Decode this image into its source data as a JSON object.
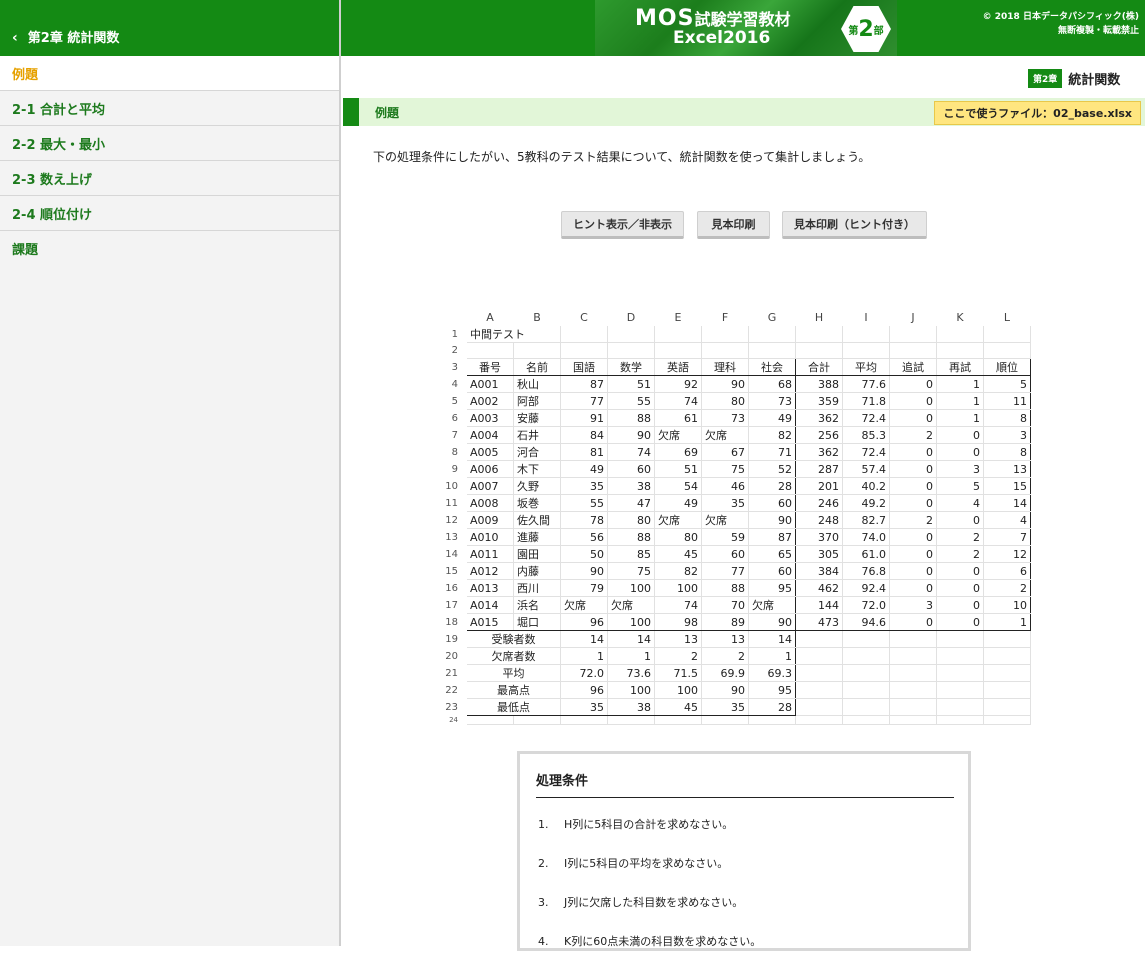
{
  "sidebar": {
    "header": "第2章 統計関数",
    "items": [
      {
        "label": "例題",
        "active": true
      },
      {
        "label": "2-1 合計と平均"
      },
      {
        "label": "2-2 最大・最小"
      },
      {
        "label": "2-3 数え上げ"
      },
      {
        "label": "2-4 順位付け"
      },
      {
        "label": "課題"
      }
    ]
  },
  "banner": {
    "line1a": "MOS",
    "line1b": "試験学習教材",
    "line2": "Excel2016",
    "part_pre": "第",
    "part_num": "2",
    "part_post": "部"
  },
  "copyright": {
    "line1": "© 2018 日本データパシフィック(株)",
    "line2": "無断複製・転載禁止"
  },
  "chapter": {
    "badge": "第2章",
    "title": "統計関数"
  },
  "section": {
    "label": "例題",
    "file": "ここで使うファイル：02_base.xlsx"
  },
  "intro": "下の処理条件にしたがい、5教科のテスト結果について、統計関数を使って集計しましょう。",
  "buttons": {
    "hint": "ヒント表示／非表示",
    "print": "見本印刷",
    "print_hint": "見本印刷（ヒント付き）"
  },
  "sheet": {
    "columns": [
      "A",
      "B",
      "C",
      "D",
      "E",
      "F",
      "G",
      "H",
      "I",
      "J",
      "K",
      "L"
    ],
    "title": "中間テスト",
    "headers": [
      "番号",
      "名前",
      "国語",
      "数学",
      "英語",
      "理科",
      "社会",
      "合計",
      "平均",
      "追試",
      "再試",
      "順位"
    ],
    "rows": [
      [
        "A001",
        "秋山",
        "87",
        "51",
        "92",
        "90",
        "68",
        "388",
        "77.6",
        "0",
        "1",
        "5"
      ],
      [
        "A002",
        "阿部",
        "77",
        "55",
        "74",
        "80",
        "73",
        "359",
        "71.8",
        "0",
        "1",
        "11"
      ],
      [
        "A003",
        "安藤",
        "91",
        "88",
        "61",
        "73",
        "49",
        "362",
        "72.4",
        "0",
        "1",
        "8"
      ],
      [
        "A004",
        "石井",
        "84",
        "90",
        "欠席",
        "欠席",
        "82",
        "256",
        "85.3",
        "2",
        "0",
        "3"
      ],
      [
        "A005",
        "河合",
        "81",
        "74",
        "69",
        "67",
        "71",
        "362",
        "72.4",
        "0",
        "0",
        "8"
      ],
      [
        "A006",
        "木下",
        "49",
        "60",
        "51",
        "75",
        "52",
        "287",
        "57.4",
        "0",
        "3",
        "13"
      ],
      [
        "A007",
        "久野",
        "35",
        "38",
        "54",
        "46",
        "28",
        "201",
        "40.2",
        "0",
        "5",
        "15"
      ],
      [
        "A008",
        "坂巻",
        "55",
        "47",
        "49",
        "35",
        "60",
        "246",
        "49.2",
        "0",
        "4",
        "14"
      ],
      [
        "A009",
        "佐久間",
        "78",
        "80",
        "欠席",
        "欠席",
        "90",
        "248",
        "82.7",
        "2",
        "0",
        "4"
      ],
      [
        "A010",
        "進藤",
        "56",
        "88",
        "80",
        "59",
        "87",
        "370",
        "74.0",
        "0",
        "2",
        "7"
      ],
      [
        "A011",
        "園田",
        "50",
        "85",
        "45",
        "60",
        "65",
        "305",
        "61.0",
        "0",
        "2",
        "12"
      ],
      [
        "A012",
        "内藤",
        "90",
        "75",
        "82",
        "77",
        "60",
        "384",
        "76.8",
        "0",
        "0",
        "6"
      ],
      [
        "A013",
        "西川",
        "79",
        "100",
        "100",
        "88",
        "95",
        "462",
        "92.4",
        "0",
        "0",
        "2"
      ],
      [
        "A014",
        "浜名",
        "欠席",
        "欠席",
        "74",
        "70",
        "欠席",
        "144",
        "72.0",
        "3",
        "0",
        "10"
      ],
      [
        "A015",
        "堀口",
        "96",
        "100",
        "98",
        "89",
        "90",
        "473",
        "94.6",
        "0",
        "0",
        "1"
      ]
    ],
    "summary": [
      {
        "label": "受験者数",
        "values": [
          "14",
          "14",
          "13",
          "13",
          "14"
        ]
      },
      {
        "label": "欠席者数",
        "values": [
          "1",
          "1",
          "2",
          "2",
          "1"
        ]
      },
      {
        "label": "平均",
        "values": [
          "72.0",
          "73.6",
          "71.5",
          "69.9",
          "69.3"
        ]
      },
      {
        "label": "最高点",
        "values": [
          "96",
          "100",
          "100",
          "90",
          "95"
        ]
      },
      {
        "label": "最低点",
        "values": [
          "35",
          "38",
          "45",
          "35",
          "28"
        ]
      }
    ]
  },
  "conditions": {
    "title": "処理条件",
    "items": [
      {
        "n": "1.",
        "text": "H列に5科目の合計を求めなさい。"
      },
      {
        "n": "2.",
        "text": "I列に5科目の平均を求めなさい。"
      },
      {
        "n": "3.",
        "text": "J列に欠席した科目数を求めなさい。"
      },
      {
        "n": "4.",
        "text": "K列に60点未満の科目数を求めなさい。"
      }
    ]
  }
}
